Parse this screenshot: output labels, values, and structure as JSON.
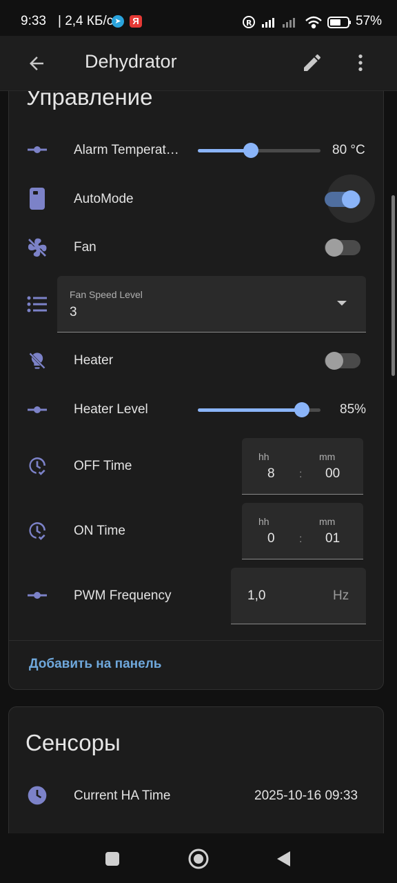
{
  "status_bar": {
    "time": "9:33",
    "network_speed": "| 2,4 КБ/с",
    "battery_percent": "57%"
  },
  "header": {
    "title": "Dehydrator"
  },
  "controls": {
    "section_title": "Управление",
    "alarm_temperature": {
      "label": "Alarm Temperat…",
      "value": "80 °C",
      "level": 0.43
    },
    "auto_mode": {
      "label": "AutoMode",
      "on": true
    },
    "fan": {
      "label": "Fan",
      "on": false
    },
    "fan_speed_level": {
      "label": "Fan Speed Level",
      "value": "3"
    },
    "heater": {
      "label": "Heater",
      "on": false
    },
    "heater_level": {
      "label": "Heater Level",
      "value": "85%",
      "level": 0.85
    },
    "off_time": {
      "label": "OFF Time",
      "hh_label": "hh",
      "mm_label": "mm",
      "hh": "8",
      "mm": "00",
      "sep": ":"
    },
    "on_time": {
      "label": "ON Time",
      "hh_label": "hh",
      "mm_label": "mm",
      "hh": "0",
      "mm": "01",
      "sep": ":"
    },
    "pwm_frequency": {
      "label": "PWM Frequency",
      "value": "1,0",
      "unit": "Hz"
    },
    "add_to_panel": "Добавить на панель"
  },
  "sensors": {
    "section_title": "Сенсоры",
    "current_ha_time": {
      "label": "Current HA Time",
      "value": "2025-10-16 09:33"
    }
  },
  "colors": {
    "accent": "#8ab4f8",
    "icon": "#7c82c8",
    "link": "#6fa8dc",
    "card_bg": "#1c1c1c",
    "page_bg": "#111111"
  },
  "icons": {
    "back": "arrow-left-icon",
    "edit": "pencil-icon",
    "menu": "dots-vertical-icon",
    "slider_entity": "ray-vertex-icon",
    "auto_mode": "remote-icon",
    "fan": "fan-off-icon",
    "fan_speed": "format-list-bulleted-icon",
    "heater": "lightbulb-off-icon",
    "time": "clock-check-icon",
    "sensor_time": "clock-icon"
  }
}
